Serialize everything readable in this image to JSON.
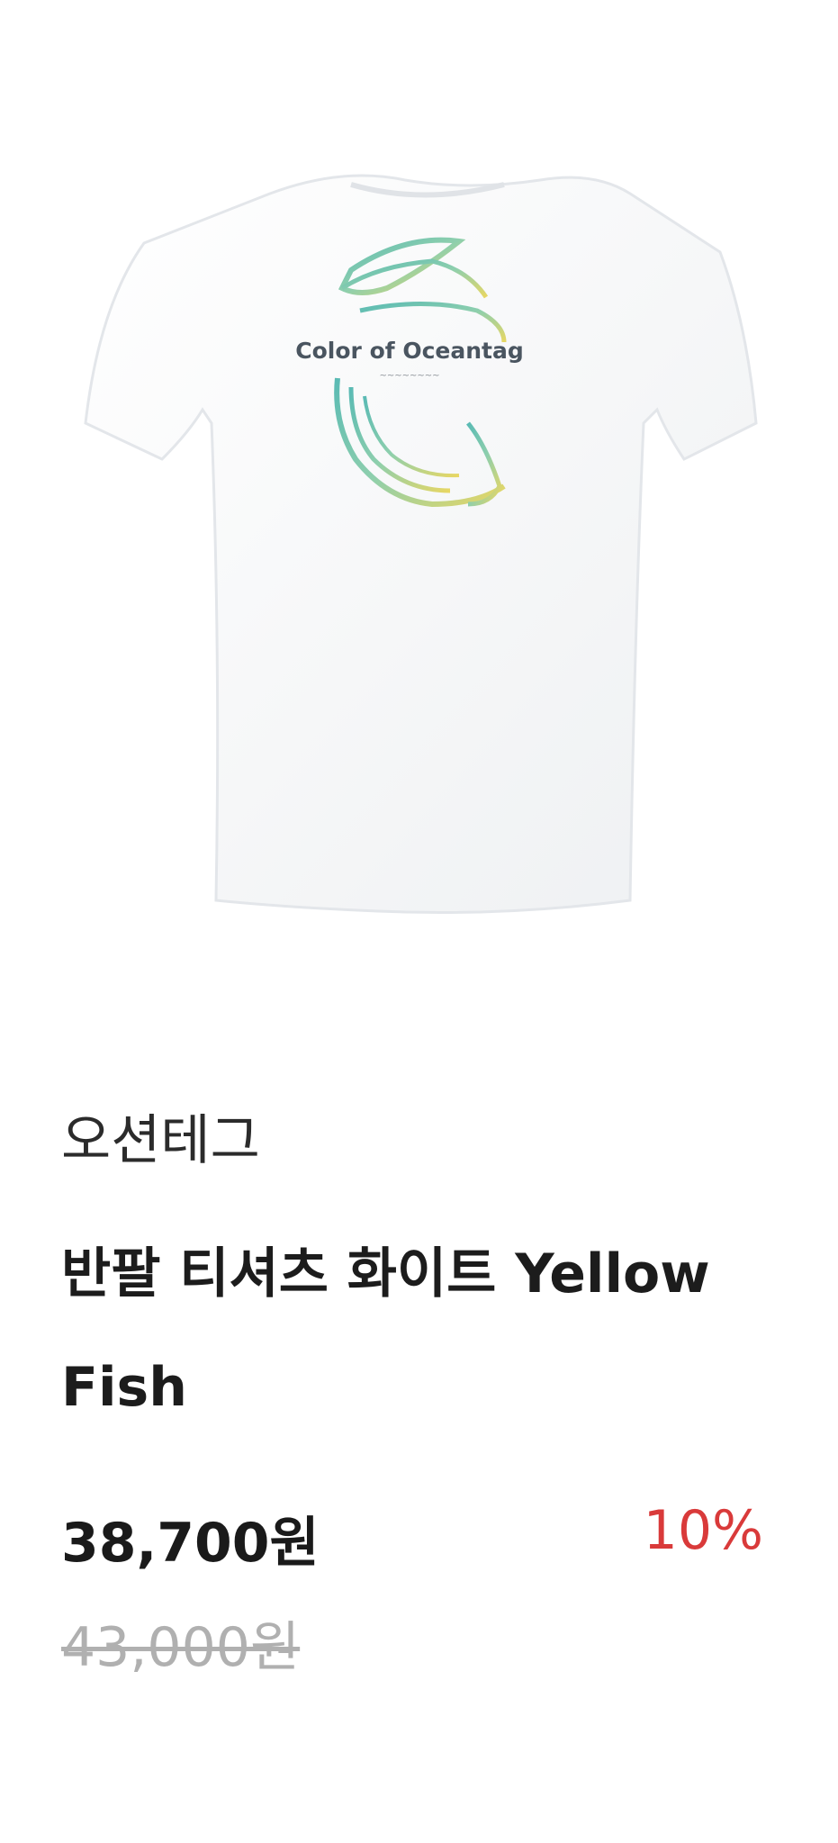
{
  "product": {
    "image_alt": "Oceantag white short sleeve T-shirt back view with yellow fish print",
    "print_text": "Color of Oceantag",
    "brand": "오션테그",
    "name": "반팔 티셔츠 화이트 Yellow Fish",
    "price": "38,700원",
    "discount": "10%",
    "original_price": "43,000원"
  },
  "colors": {
    "discount": "#d93a3a",
    "original_price": "#b0b0b0",
    "print_teal": "#3fb0a8",
    "print_yellow": "#e6d24a"
  }
}
